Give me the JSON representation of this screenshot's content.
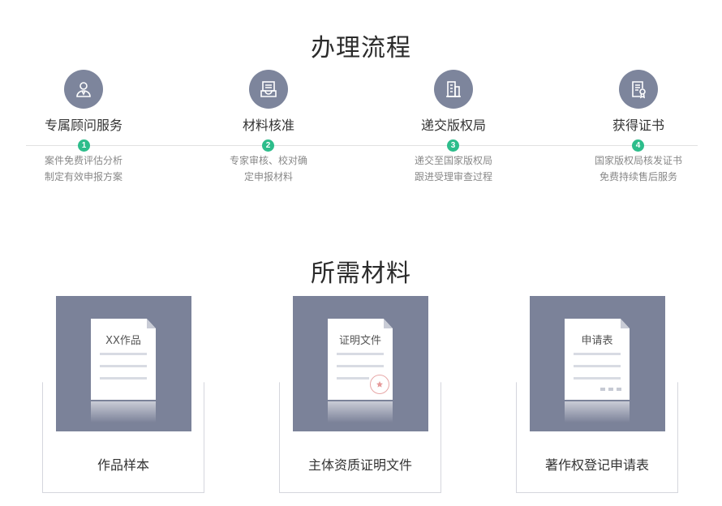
{
  "process": {
    "title": "办理流程",
    "steps": [
      {
        "num": "1",
        "icon": "consultant-icon",
        "name": "专属顾问服务",
        "desc1": "案件免费评估分析",
        "desc2": "制定有效申报方案"
      },
      {
        "num": "2",
        "icon": "inbox-tray-icon",
        "name": "材料核准",
        "desc1": "专家审核、校对确",
        "desc2": "定申报材料"
      },
      {
        "num": "3",
        "icon": "building-icon",
        "name": "递交版权局",
        "desc1": "递交至国家版权局",
        "desc2": "跟进受理审查过程"
      },
      {
        "num": "4",
        "icon": "certificate-icon",
        "name": "获得证书",
        "desc1": "国家版权局核发证书",
        "desc2": "免费持续售后服务"
      }
    ]
  },
  "materials": {
    "title": "所需材料",
    "items": [
      {
        "paper_title": "XX作品",
        "label": "作品样本"
      },
      {
        "paper_title": "证明文件",
        "label": "主体资质证明文件"
      },
      {
        "paper_title": "申请表",
        "label": "著作权登记申请表"
      }
    ]
  },
  "colors": {
    "icon_bg": "#7d859c",
    "dot": "#2dbd8b",
    "envelope": "#7b8299",
    "flap": "#4a5075"
  }
}
